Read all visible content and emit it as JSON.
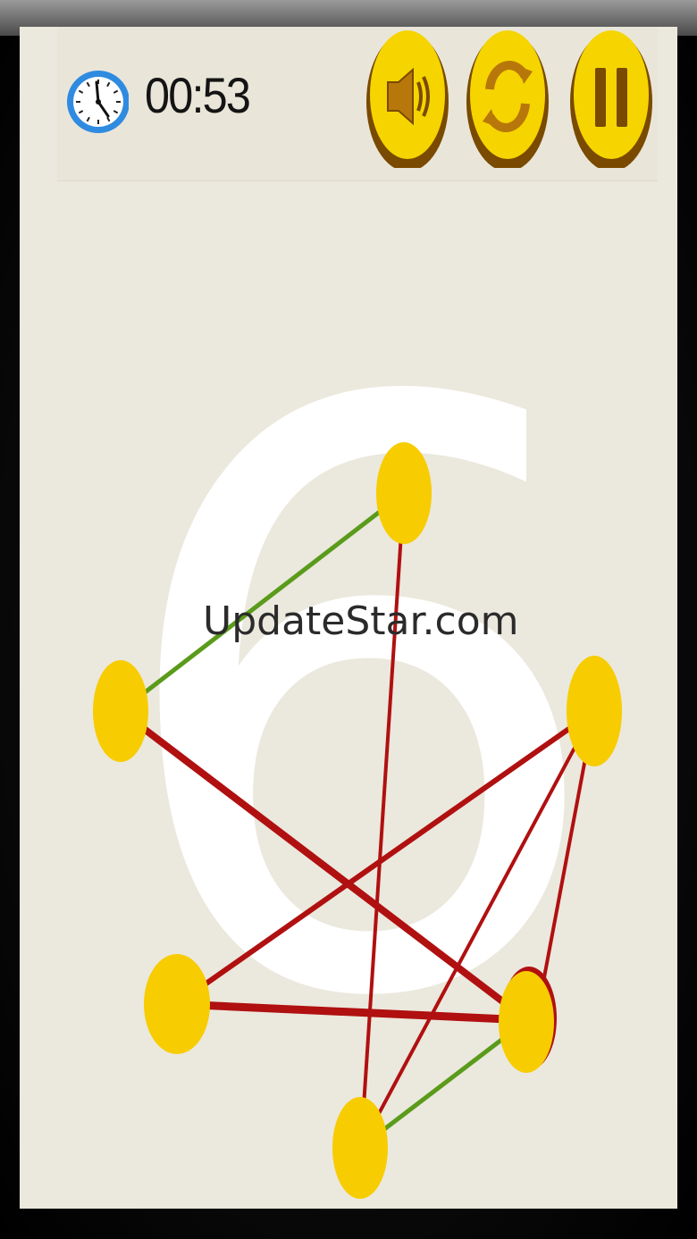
{
  "hud": {
    "timer": "00:53",
    "buttons": [
      {
        "id": "sound",
        "icon": "speaker-icon"
      },
      {
        "id": "restart",
        "icon": "refresh-icon"
      },
      {
        "id": "pause",
        "icon": "pause-icon"
      }
    ]
  },
  "level": {
    "number": "6"
  },
  "watermark": "UpdateStar.com",
  "puzzle": {
    "nodes": [
      {
        "id": "top",
        "label": ""
      },
      {
        "id": "left",
        "label": ""
      },
      {
        "id": "right",
        "label": ""
      },
      {
        "id": "lower-left",
        "label": ""
      },
      {
        "id": "lower-right",
        "label": ""
      },
      {
        "id": "bottom",
        "label": ""
      }
    ],
    "edges": [
      {
        "from": "top",
        "to": "left",
        "state": "ok"
      },
      {
        "from": "top",
        "to": "bottom",
        "state": "crossed"
      },
      {
        "from": "left",
        "to": "lower-right",
        "state": "crossed"
      },
      {
        "from": "right",
        "to": "lower-left",
        "state": "crossed"
      },
      {
        "from": "right",
        "to": "bottom",
        "state": "crossed"
      },
      {
        "from": "right",
        "to": "lower-right",
        "state": "crossed"
      },
      {
        "from": "lower-left",
        "to": "lower-right",
        "state": "crossed"
      },
      {
        "from": "lower-right",
        "to": "bottom",
        "state": "ok"
      }
    ],
    "colors": {
      "node": "#f7cc00",
      "ok_edge": "#5a9b1a",
      "crossed_edge": "#b01010",
      "button_face": "#f5d400",
      "button_rim": "#7a4a00"
    }
  }
}
